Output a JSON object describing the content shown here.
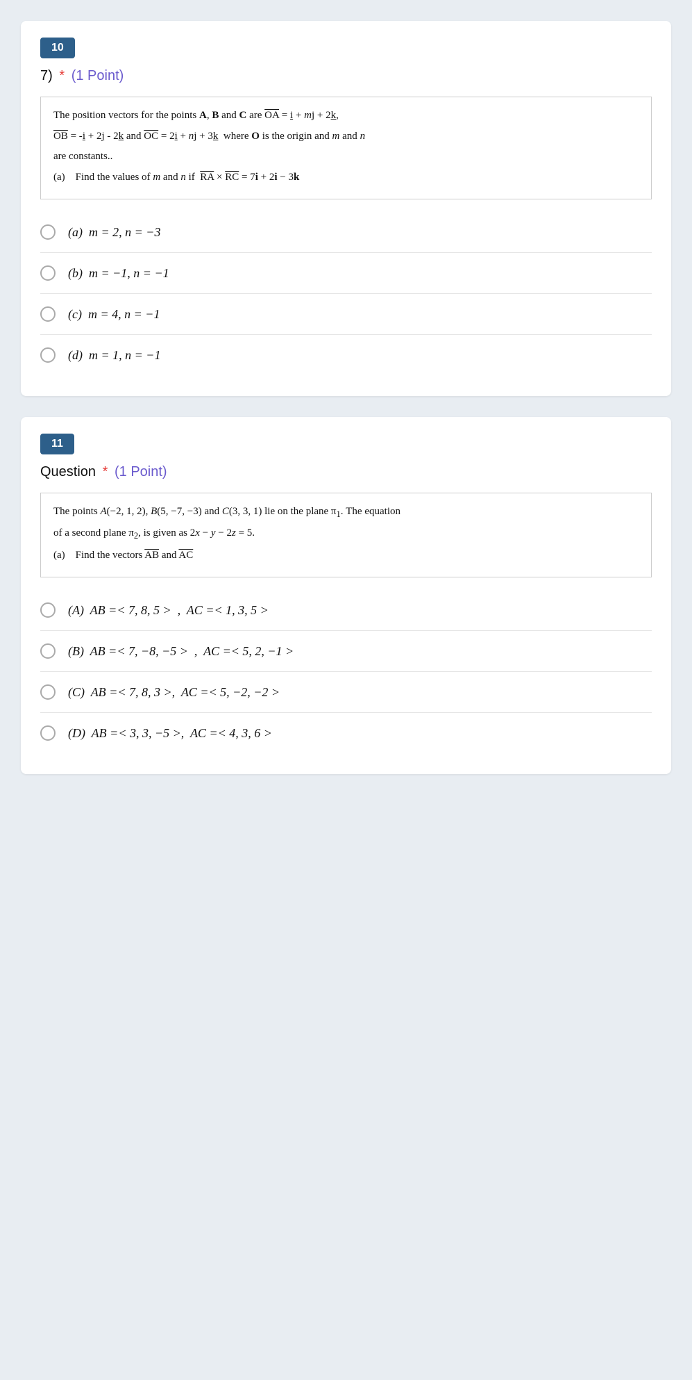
{
  "question10": {
    "number": "10",
    "title_prefix": "7)",
    "asterisk": "*",
    "points": "(1 Point)",
    "context_lines": [
      "The position vectors for the points A, B and C are OA = i + mj + 2k,",
      "OB = -i + 2j - 2k and OC = 2i + nj + 3k  where O is the origin and m and n",
      "are constants..",
      "(a)   Find the values of m and n if  RA × RC = 7i + 2i − 3k"
    ],
    "options": [
      {
        "id": "q10a",
        "label": "(a)  m = 2, n = −3"
      },
      {
        "id": "q10b",
        "label": "(b)  m = −1, n = −1"
      },
      {
        "id": "q10c",
        "label": "(c)  m = 4, n = −1"
      },
      {
        "id": "q10d",
        "label": "(d)  m = 1, n = −1"
      }
    ]
  },
  "question11": {
    "number": "11",
    "title_prefix": "Question",
    "asterisk": "*",
    "points": "(1 Point)",
    "context_lines": [
      "The points A(−2, 1, 2), B(5, −7, −3) and C(3, 3, 1) lie on the plane π₁. The equation",
      "of a second plane π₂, is given as 2x − y − 2z = 5.",
      "(a)   Find the vectors AB and AC"
    ],
    "options": [
      {
        "id": "q11A",
        "label": "(A)  AB =< 7, 8, 5 >  ,  AC =< 1, 3, 5 >"
      },
      {
        "id": "q11B",
        "label": "(B)  AB =< 7, −8, −5 >  ,  AC =< 5, 2, −1 >"
      },
      {
        "id": "q11C",
        "label": "(C)  AB =< 7, 8, 3 >,  AC =< 5, −2, −2 >"
      },
      {
        "id": "q11D",
        "label": "(D)  AB =< 3, 3, −5 >,  AC =< 4, 3, 6 >"
      }
    ]
  }
}
